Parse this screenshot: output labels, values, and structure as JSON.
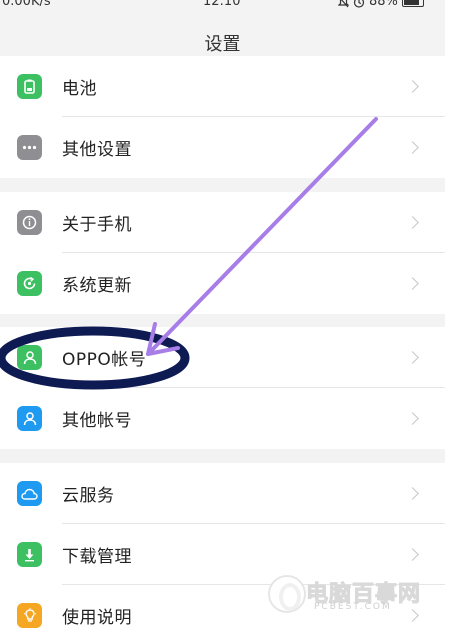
{
  "status_bar": {
    "left_text": "0.00K/s",
    "time": "12:10",
    "battery": "88%"
  },
  "header": {
    "title": "设置"
  },
  "sections": [
    {
      "items": [
        {
          "label": "电池",
          "icon": "battery-icon",
          "color": "#3cc062"
        },
        {
          "label": "其他设置",
          "icon": "more-dots-icon",
          "color": "#8e8e93"
        }
      ]
    },
    {
      "items": [
        {
          "label": "关于手机",
          "icon": "info-icon",
          "color": "#8e8e93"
        },
        {
          "label": "系统更新",
          "icon": "update-icon",
          "color": "#3cc062"
        }
      ]
    },
    {
      "items": [
        {
          "label": "OPPO帐号",
          "icon": "user-icon",
          "color": "#3cc062"
        },
        {
          "label": "其他帐号",
          "icon": "user-icon",
          "color": "#1e9af0"
        }
      ]
    },
    {
      "items": [
        {
          "label": "云服务",
          "icon": "cloud-icon",
          "color": "#1e9af0"
        },
        {
          "label": "下载管理",
          "icon": "download-icon",
          "color": "#3cc062"
        },
        {
          "label": "使用说明",
          "icon": "bulb-icon",
          "color": "#f5a623"
        }
      ]
    }
  ],
  "annotation": {
    "arrow_color": "#a77de8",
    "ellipse_color": "#0e1a52"
  },
  "watermark": {
    "text": "电脑百事网",
    "url": "PCBEST.COM"
  }
}
